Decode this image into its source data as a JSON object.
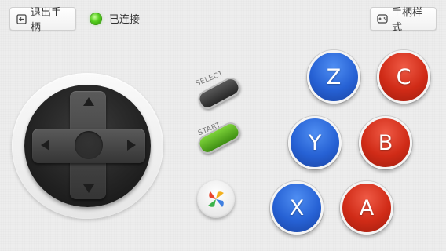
{
  "header": {
    "exit_label": "退出手柄",
    "status_text": "已连接",
    "style_label": "手柄样式"
  },
  "center": {
    "select_label": "SELECT",
    "start_label": "START"
  },
  "buttons": {
    "z": "Z",
    "c": "C",
    "y": "Y",
    "b": "B",
    "x": "X",
    "a": "A"
  },
  "colors": {
    "blue_button": "#2661d4",
    "red_button": "#d02b17",
    "status_led": "#56cf1e",
    "start_button": "#5cb625",
    "select_button": "#3a3a3a"
  },
  "icons": {
    "exit": "exit-icon",
    "style": "gamepad-icon",
    "logo": "app-logo-icon",
    "status": "connected-led-icon"
  }
}
